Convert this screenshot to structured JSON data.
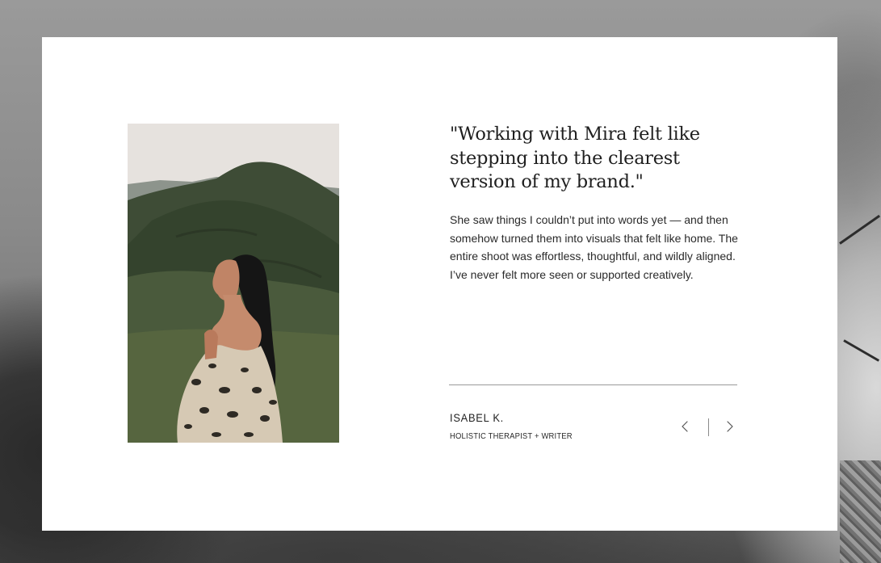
{
  "testimonial": {
    "quote": "\"Working with Mira felt like stepping into the clearest version of my brand.\"",
    "body": "She saw things I couldn’t put into words yet — and then somehow turned them into visuals that felt like home. The entire shoot was effortless, thoughtful, and wildly aligned. I’ve never felt more seen or supported creatively.",
    "author_name": "ISABEL K.",
    "author_role": "HOLISTIC THERAPIST + WRITER"
  },
  "navigation": {
    "prev_icon": "chevron-left-icon",
    "next_icon": "chevron-right-icon"
  },
  "colors": {
    "card": "#ffffff",
    "text": "#1f1f1f",
    "divider": "#9a9a9a"
  }
}
